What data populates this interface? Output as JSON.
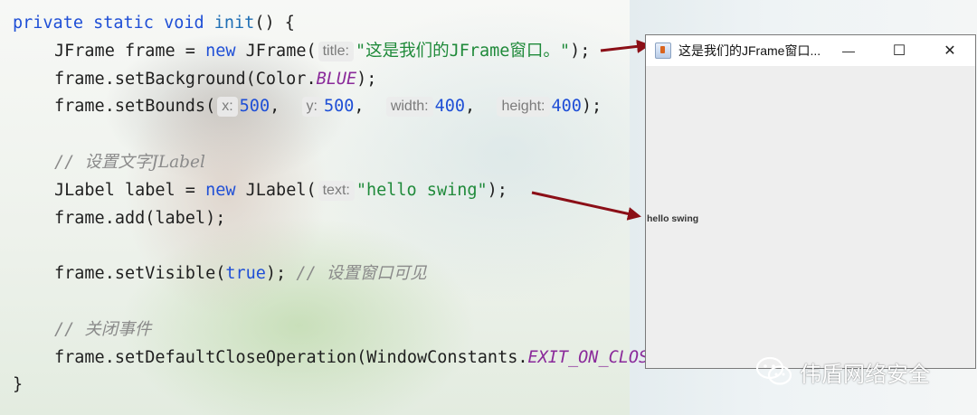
{
  "editor": {
    "lines": [
      {
        "tokens": [
          {
            "t": "private static void ",
            "c": "kw"
          },
          {
            "t": "init",
            "c": "fn"
          },
          {
            "t": "() {",
            "c": ""
          }
        ]
      },
      {
        "tokens": [
          {
            "t": "JFrame frame = ",
            "c": ""
          },
          {
            "t": "new ",
            "c": "kw"
          },
          {
            "t": "JFrame(",
            "c": ""
          },
          {
            "t": "title:",
            "c": "hint"
          },
          {
            "t": "\"这是我们的JFrame窗口。\"",
            "c": "str"
          },
          {
            "t": ");",
            "c": ""
          }
        ]
      },
      {
        "tokens": [
          {
            "t": "frame.setBackground(Color.",
            "c": ""
          },
          {
            "t": "BLUE",
            "c": "const"
          },
          {
            "t": ");",
            "c": ""
          }
        ]
      },
      {
        "tokens": [
          {
            "t": "frame.setBounds(",
            "c": ""
          },
          {
            "t": "x:",
            "c": "hint"
          },
          {
            "t": "500",
            "c": "num"
          },
          {
            "t": ",  ",
            "c": ""
          },
          {
            "t": "y:",
            "c": "hint"
          },
          {
            "t": "500",
            "c": "num"
          },
          {
            "t": ",  ",
            "c": ""
          },
          {
            "t": "width:",
            "c": "hint"
          },
          {
            "t": "400",
            "c": "num"
          },
          {
            "t": ",  ",
            "c": ""
          },
          {
            "t": "height:",
            "c": "hint"
          },
          {
            "t": "400",
            "c": "num"
          },
          {
            "t": ");",
            "c": ""
          }
        ]
      },
      {
        "tokens": []
      },
      {
        "tokens": [
          {
            "t": "// ",
            "c": "cmt"
          },
          {
            "t": "设置文字JLabel",
            "c": "cmt cmt-cn"
          }
        ]
      },
      {
        "tokens": [
          {
            "t": "JLabel label = ",
            "c": ""
          },
          {
            "t": "new ",
            "c": "kw"
          },
          {
            "t": "JLabel(",
            "c": ""
          },
          {
            "t": "text:",
            "c": "hint"
          },
          {
            "t": "\"hello swing\"",
            "c": "str"
          },
          {
            "t": ");",
            "c": ""
          }
        ]
      },
      {
        "tokens": [
          {
            "t": "frame.add(label);",
            "c": ""
          }
        ]
      },
      {
        "tokens": []
      },
      {
        "tokens": [
          {
            "t": "frame.setVisible(",
            "c": ""
          },
          {
            "t": "true",
            "c": "kw"
          },
          {
            "t": "); ",
            "c": ""
          },
          {
            "t": "// ",
            "c": "cmt"
          },
          {
            "t": "设置窗口可见",
            "c": "cmt cmt-cn"
          }
        ]
      },
      {
        "tokens": []
      },
      {
        "tokens": [
          {
            "t": "// ",
            "c": "cmt"
          },
          {
            "t": "关闭事件",
            "c": "cmt cmt-cn"
          }
        ]
      },
      {
        "tokens": [
          {
            "t": "frame.setDefaultCloseOperation(WindowConstants.",
            "c": ""
          },
          {
            "t": "EXIT_ON_CLOSE",
            "c": "const"
          },
          {
            "t": ");",
            "c": ""
          }
        ]
      },
      {
        "tokens": [
          {
            "t": "}",
            "c": ""
          }
        ]
      }
    ]
  },
  "jframe": {
    "title": "这是我们的JFrame窗口...",
    "label": "hello swing",
    "minimize_glyph": "—",
    "maximize_glyph": "☐",
    "close_glyph": "✕"
  },
  "watermark": {
    "text": "伟盾网络安全"
  },
  "colors": {
    "arrow": "#8b0f17",
    "keyword": "#1f4fd6",
    "string": "#1f8a3a",
    "constant": "#8a2a9a",
    "comment": "#8a8a8a"
  }
}
